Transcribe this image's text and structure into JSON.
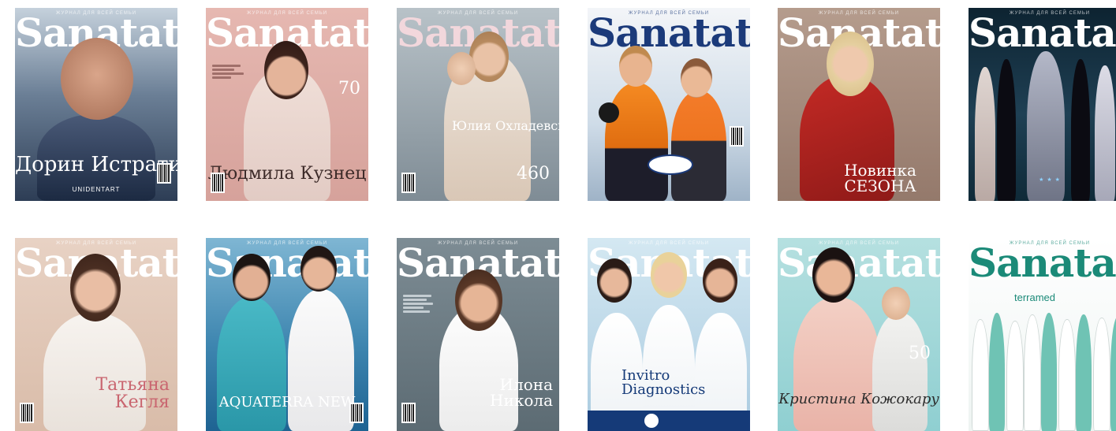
{
  "masthead": "Sanatate",
  "kicker": "журнал для всей семьи",
  "covers": [
    {
      "headline": "Дорин Истрати",
      "sub": "UNIDENTART",
      "bg": "#5b6f8c",
      "masthead_color": "#ffffff",
      "headline_color": "#ffffff"
    },
    {
      "headline": "Людмила Кузнец",
      "sub": "",
      "bg": "#dcaaa3",
      "masthead_color": "#ffffff",
      "headline_color": "#3c2a28"
    },
    {
      "headline": "Юлия Охладевска",
      "sub": "",
      "bg": "#9aa4ab",
      "masthead_color": "#f2d7dc",
      "headline_color": "#ffffff"
    },
    {
      "headline": "",
      "sub": "",
      "bg": "#d8e4ee",
      "masthead_color": "#1b3a7a",
      "headline_color": "#1b3a7a"
    },
    {
      "headline": "Новинка СЕЗОНА",
      "sub": "",
      "bg": "#a68b7c",
      "masthead_color": "#ffffff",
      "headline_color": "#ffffff"
    },
    {
      "headline": "",
      "sub": "",
      "bg": "#15303f",
      "masthead_color": "#ffffff",
      "headline_color": "#ffffff"
    },
    {
      "headline": "Татьяна Кегля",
      "sub": "",
      "bg": "#dfc6b7",
      "masthead_color": "#ffffff",
      "headline_color": "#c9656f"
    },
    {
      "headline": "AQUATERRA NEW",
      "sub": "",
      "bg": "#4c91b8",
      "masthead_color": "#ffffff",
      "headline_color": "#ffffff"
    },
    {
      "headline": "Илона Никола",
      "sub": "",
      "bg": "#6f7e86",
      "masthead_color": "#ffffff",
      "headline_color": "#ffffff"
    },
    {
      "headline": "Invitro Diagnostics",
      "sub": "",
      "bg": "#bcd9e8",
      "masthead_color": "#ffffff",
      "headline_color": "#153a78"
    },
    {
      "headline": "Кристина Кожокару",
      "sub": "",
      "bg": "#9fd3d3",
      "masthead_color": "#ffffff",
      "headline_color": "#2d2d2d"
    },
    {
      "headline": "terramed",
      "sub": "",
      "bg": "#f3f6f5",
      "masthead_color": "#1b8a78",
      "headline_color": "#1b8a78"
    }
  ]
}
